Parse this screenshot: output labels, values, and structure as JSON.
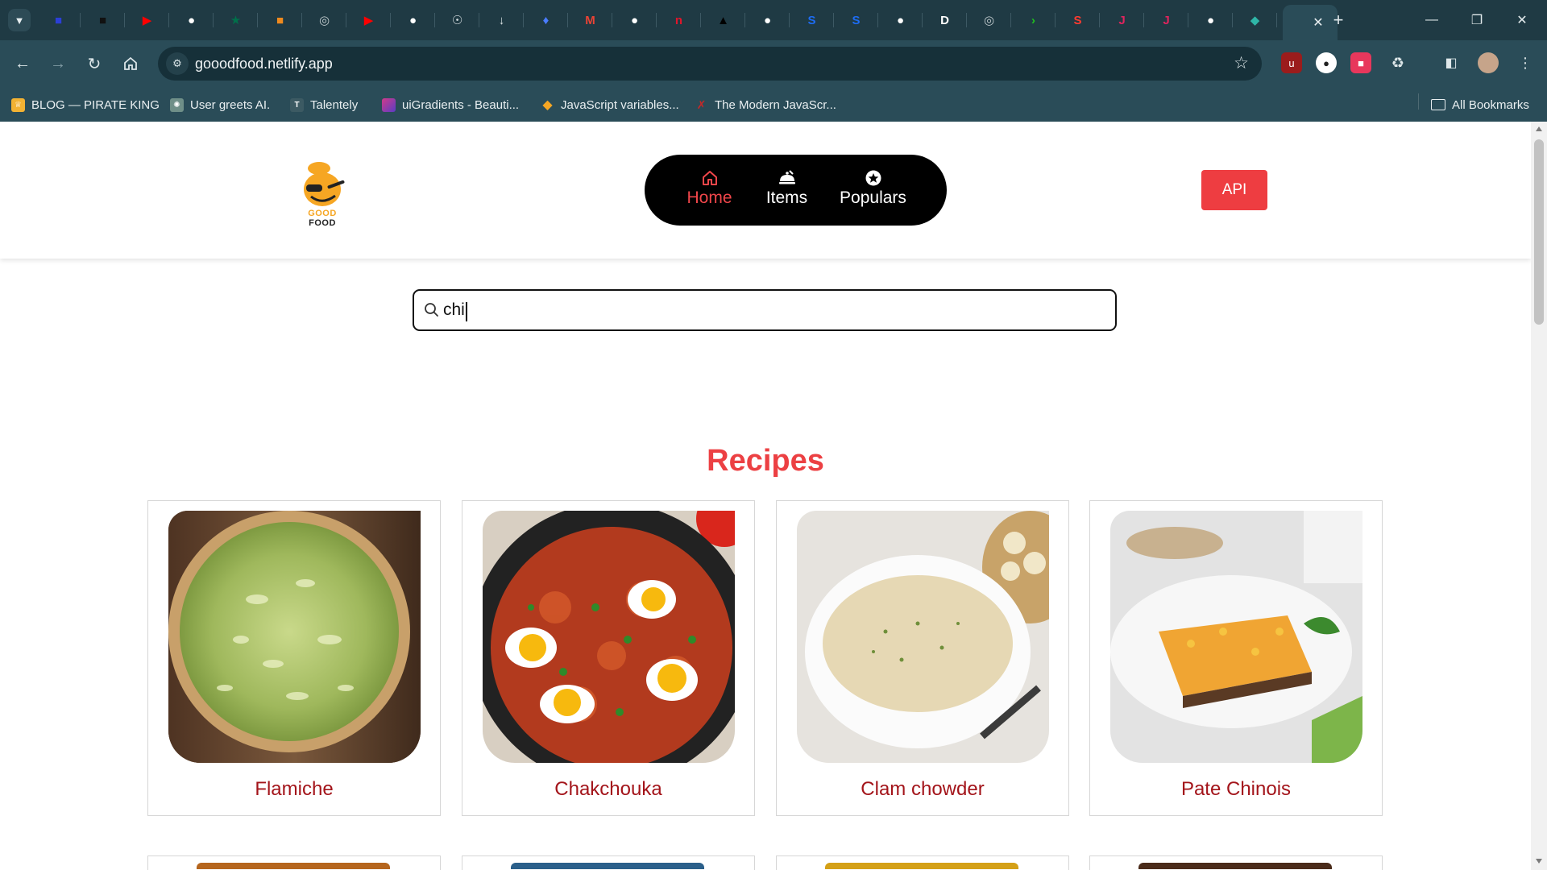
{
  "browser": {
    "tabs": [
      {
        "icon": "blue-square-icon",
        "color": "#2b3fd6"
      },
      {
        "icon": "black-square-icon",
        "color": "#111111"
      },
      {
        "icon": "youtube-icon",
        "color": "#ff0000"
      },
      {
        "icon": "github-icon",
        "color": "#ffffff"
      },
      {
        "icon": "starbucks-icon",
        "color": "#00704a"
      },
      {
        "icon": "cup-icon",
        "color": "#ef8a1e"
      },
      {
        "icon": "globe-icon",
        "color": "#bfc9cc"
      },
      {
        "icon": "youtube-icon",
        "color": "#ff0000"
      },
      {
        "icon": "github-icon",
        "color": "#ffffff"
      },
      {
        "icon": "reel-icon",
        "color": "#d9e1e3"
      },
      {
        "icon": "download-icon",
        "color": "#d9e1e3"
      },
      {
        "icon": "fire-icon",
        "color": "#4a7cff"
      },
      {
        "icon": "gmail-icon",
        "color": "#ea4335"
      },
      {
        "icon": "github-icon",
        "color": "#ffffff"
      },
      {
        "icon": "red-n-icon",
        "color": "#e0162b"
      },
      {
        "icon": "triangle-icon",
        "color": "#000000"
      },
      {
        "icon": "github-icon",
        "color": "#ffffff"
      },
      {
        "icon": "s-icon",
        "color": "#1d6cf2"
      },
      {
        "icon": "s-icon",
        "color": "#1d6cf2"
      },
      {
        "icon": "github-icon",
        "color": "#ffffff"
      },
      {
        "icon": "d-icon",
        "color": "#ffffff"
      },
      {
        "icon": "globe-icon",
        "color": "#bfc9cc"
      },
      {
        "icon": "terminal-icon",
        "color": "#1ec21e"
      },
      {
        "icon": "s-red-icon",
        "color": "#ff3b30"
      },
      {
        "icon": "j-icon",
        "color": "#e0245e"
      },
      {
        "icon": "j-icon",
        "color": "#e0245e"
      },
      {
        "icon": "github-icon",
        "color": "#ffffff"
      },
      {
        "icon": "netlify-icon",
        "color": "#2fb6a8"
      }
    ],
    "url": "gooodfood.netlify.app",
    "bookmarks": [
      {
        "label": "BLOG — PIRATE KING",
        "icon": "crown-icon",
        "color": "#f2b233"
      },
      {
        "label": "User greets AI.",
        "icon": "chatgpt-icon",
        "color": "#6f8f88"
      },
      {
        "label": "Talentely",
        "icon": "t-icon",
        "color": "#3c5a63"
      },
      {
        "label": "uiGradients - Beauti...",
        "icon": "gradient-icon",
        "color": "#b03aa0"
      },
      {
        "label": "JavaScript variables...",
        "icon": "diamond-icon",
        "color": "#f5a623"
      },
      {
        "label": "The Modern JavaScr...",
        "icon": "x-icon",
        "color": "#c62828"
      }
    ],
    "all_bookmarks": "All Bookmarks"
  },
  "header": {
    "logo_text": "GOOD FOOD",
    "nav": [
      {
        "label": "Home",
        "icon": "home-icon"
      },
      {
        "label": "Items",
        "icon": "dish-icon"
      },
      {
        "label": "Populars",
        "icon": "star-circle-icon"
      }
    ],
    "api_button": "API"
  },
  "search": {
    "value": "chi",
    "placeholder": ""
  },
  "recipes": {
    "title": "Recipes",
    "items": [
      {
        "name": "Flamiche"
      },
      {
        "name": "Chakchouka"
      },
      {
        "name": "Clam chowder"
      },
      {
        "name": "Pate Chinois"
      }
    ]
  },
  "colors": {
    "accent": "#ec4043",
    "recipe_label": "#a3141a",
    "chrome": "#2a4c58"
  }
}
